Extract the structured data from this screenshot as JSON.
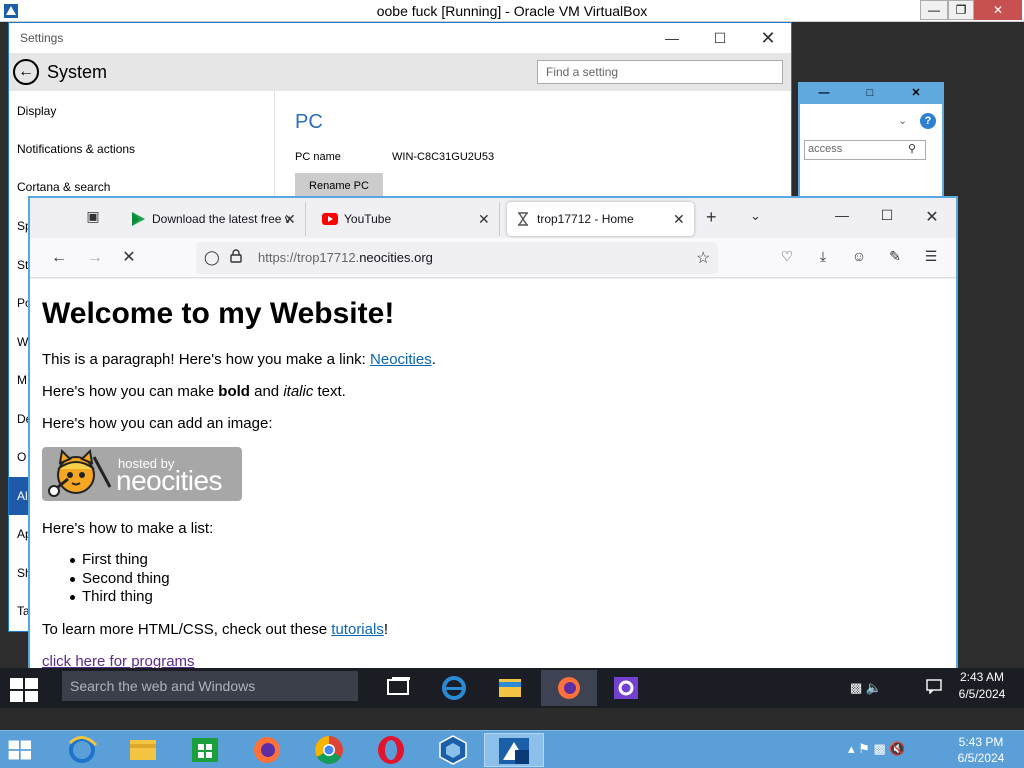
{
  "host": {
    "window_title": "oobe fuck [Running] - Oracle VM VirtualBox",
    "controls": {
      "minimize": "—",
      "restore": "❐",
      "close": "✕"
    },
    "taskbar": {
      "apps": [
        "start-icon",
        "internet-explorer-icon",
        "file-explorer-icon",
        "store-icon",
        "firefox-icon",
        "chrome-icon",
        "opera-icon",
        "virtualbox-icon",
        "virtualbox-vm-icon"
      ],
      "time": "5:43 PM",
      "date": "6/5/2024"
    },
    "colors": {
      "taskbar": "#5b9fd9"
    }
  },
  "settings": {
    "window_title": "Settings",
    "page_title": "System",
    "search_placeholder": "Find a setting",
    "nav_items": [
      {
        "label": "Display"
      },
      {
        "label": "Notifications & actions"
      },
      {
        "label": "Cortana & search"
      },
      {
        "label": "Sp"
      },
      {
        "label": "St"
      },
      {
        "label": "Po"
      },
      {
        "label": "W"
      },
      {
        "label": "M"
      },
      {
        "label": "De"
      },
      {
        "label": "O"
      },
      {
        "label": "Al",
        "selected": true
      },
      {
        "label": "Ap"
      },
      {
        "label": "Sh"
      },
      {
        "label": "Ta"
      }
    ],
    "content": {
      "heading": "PC",
      "pc_name_label": "PC name",
      "pc_name_value": "WIN-C8C31GU2U53",
      "rename_button": "Rename PC"
    }
  },
  "background_window": {
    "search_placeholder": "access"
  },
  "firefox": {
    "tabs": [
      {
        "label": "Download the latest free v",
        "icon": "play-store-icon"
      },
      {
        "label": "YouTube",
        "icon": "youtube-icon"
      },
      {
        "label": "trop17712 - Home",
        "icon": "hourglass-icon",
        "active": true
      }
    ],
    "url_prefix": "https://trop17712.",
    "url_host": "neocities.org",
    "page": {
      "h1": "Welcome to my Website!",
      "p1_before": "This is a paragraph! Here's how you make a link: ",
      "p1_link": "Neocities",
      "p1_after": ".",
      "p2_before": "Here's how you can make ",
      "p2_bold": "bold",
      "p2_mid": " and ",
      "p2_italic": "italic",
      "p2_after": " text.",
      "p3": "Here's how you can add an image:",
      "badge_small": "hosted by",
      "badge_brand": "neocities",
      "p4": "Here's how to make a list:",
      "list": [
        "First thing",
        "Second thing",
        "Third thing"
      ],
      "p5_before": "To learn more HTML/CSS, check out these ",
      "p5_link": "tutorials",
      "p5_after": "!",
      "p6_link": "click here for programs"
    }
  },
  "guest_taskbar": {
    "search_placeholder": "Search the web and Windows",
    "time": "2:43 AM",
    "date": "6/5/2024"
  }
}
